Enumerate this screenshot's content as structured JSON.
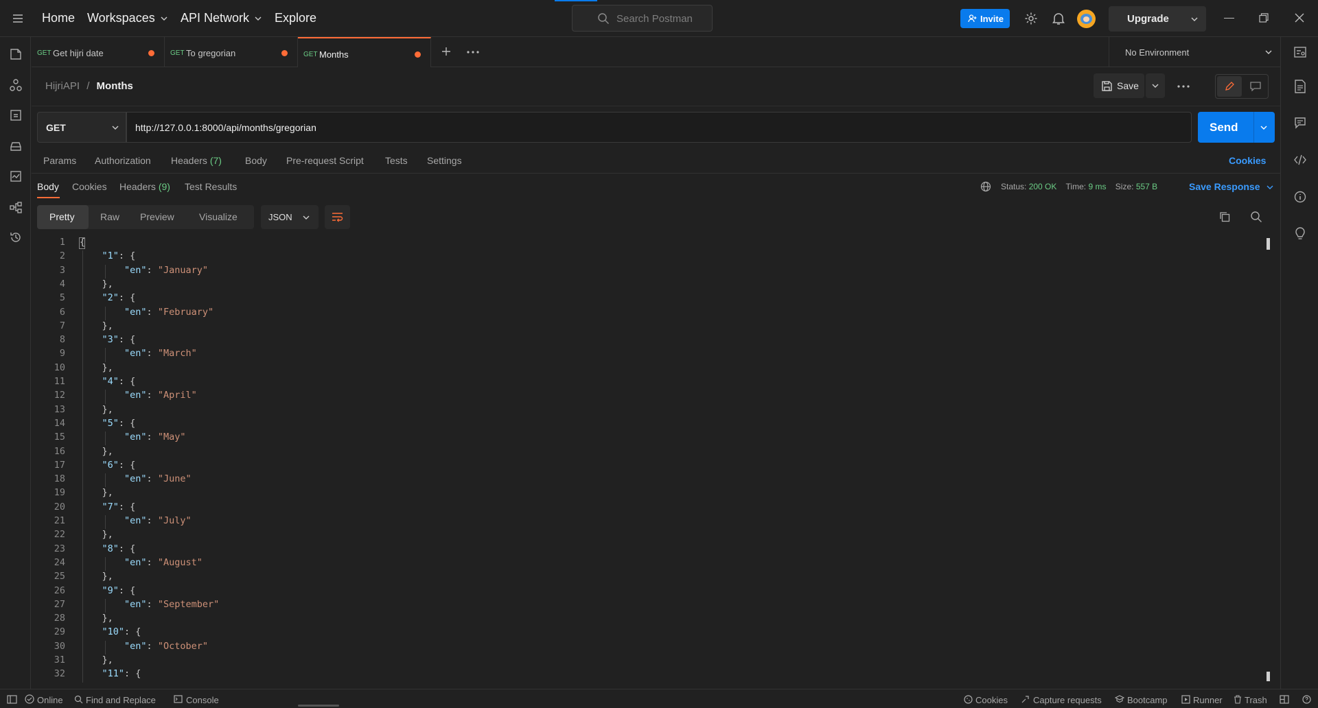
{
  "topbar": {
    "nav": {
      "home": "Home",
      "workspaces": "Workspaces",
      "api_network": "API Network",
      "explore": "Explore"
    },
    "search_placeholder": "Search Postman",
    "invite_label": "Invite",
    "upgrade_label": "Upgrade"
  },
  "tabs": [
    {
      "method": "GET",
      "name": "Get hijri date",
      "unsaved": true
    },
    {
      "method": "GET",
      "name": "To gregorian",
      "unsaved": true
    },
    {
      "method": "GET",
      "name": "Months",
      "unsaved": true,
      "active": true
    }
  ],
  "environment": "No Environment",
  "breadcrumb": {
    "parent": "HijriAPI",
    "separator": "/",
    "current": "Months"
  },
  "save_label": "Save",
  "request": {
    "method": "GET",
    "url": "http://127.0.0.1:8000/api/months/gregorian",
    "send_label": "Send"
  },
  "request_tabs": {
    "params": "Params",
    "authorization": "Authorization",
    "headers": "Headers",
    "headers_count": "(7)",
    "body": "Body",
    "pre_request": "Pre-request Script",
    "tests": "Tests",
    "settings": "Settings",
    "cookies": "Cookies"
  },
  "response_tabs": {
    "body": "Body",
    "cookies": "Cookies",
    "headers": "Headers",
    "headers_count": "(9)",
    "test_results": "Test Results"
  },
  "response_status": {
    "status_label": "Status:",
    "status_value": "200 OK",
    "time_label": "Time:",
    "time_value": "9 ms",
    "size_label": "Size:",
    "size_value": "557 B",
    "save_response": "Save Response"
  },
  "view_modes": {
    "pretty": "Pretty",
    "raw": "Raw",
    "preview": "Preview",
    "visualize": "Visualize"
  },
  "format": "JSON",
  "code_lines": [
    "{",
    "    \"1\": {",
    "        \"en\": \"January\"",
    "    },",
    "    \"2\": {",
    "        \"en\": \"February\"",
    "    },",
    "    \"3\": {",
    "        \"en\": \"March\"",
    "    },",
    "    \"4\": {",
    "        \"en\": \"April\"",
    "    },",
    "    \"5\": {",
    "        \"en\": \"May\"",
    "    },",
    "    \"6\": {",
    "        \"en\": \"June\"",
    "    },",
    "    \"7\": {",
    "        \"en\": \"July\"",
    "    },",
    "    \"8\": {",
    "        \"en\": \"August\"",
    "    },",
    "    \"9\": {",
    "        \"en\": \"September\"",
    "    },",
    "    \"10\": {",
    "        \"en\": \"October\"",
    "    },",
    "    \"11\": {"
  ],
  "statusbar": {
    "online": "Online",
    "find_replace": "Find and Replace",
    "console": "Console",
    "cookies": "Cookies",
    "capture": "Capture requests",
    "bootcamp": "Bootcamp",
    "runner": "Runner",
    "trash": "Trash"
  },
  "colors": {
    "accent": "#ff6c37",
    "primary": "#097bed",
    "success": "#6bcc85",
    "link": "#3a9bff"
  }
}
